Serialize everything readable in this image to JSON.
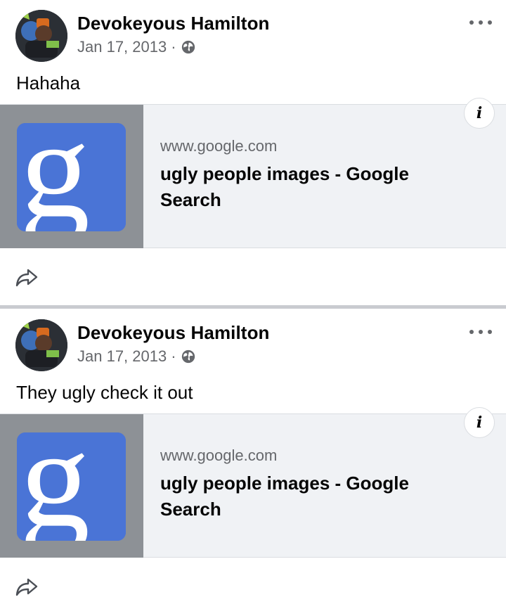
{
  "posts": [
    {
      "author": "Devokeyous Hamilton",
      "date": "Jan 17, 2013",
      "separator": "·",
      "message": "Hahaha",
      "link": {
        "domain": "www.google.com",
        "title": "ugly people images - Google Search",
        "thumb_letter": "g"
      },
      "info_label": "i",
      "icons": {
        "more": "more-options-icon",
        "privacy": "globe-icon",
        "share": "share-icon"
      }
    },
    {
      "author": "Devokeyous Hamilton",
      "date": "Jan 17, 2013",
      "separator": "·",
      "message": "They ugly check it out",
      "link": {
        "domain": "www.google.com",
        "title": "ugly people images - Google Search",
        "thumb_letter": "g"
      },
      "info_label": "i",
      "icons": {
        "more": "more-options-icon",
        "privacy": "globe-icon",
        "share": "share-icon"
      }
    }
  ],
  "colors": {
    "google_blue": "#4a74d6",
    "card_bg": "#f0f2f5",
    "thumb_bg": "#8d9196",
    "secondary_text": "#65676b"
  }
}
